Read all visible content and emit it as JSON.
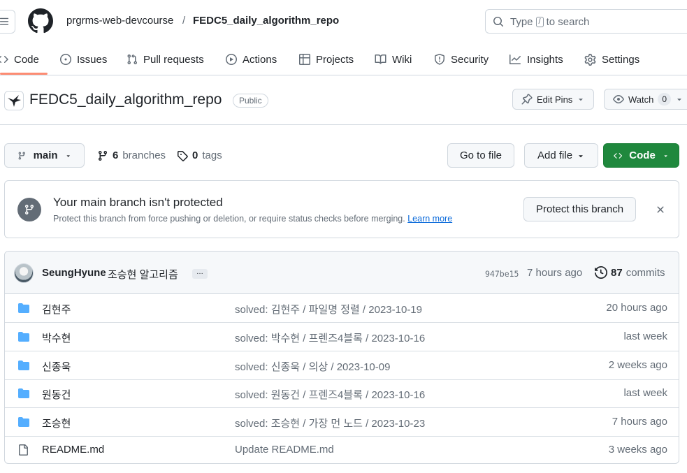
{
  "header": {
    "owner": "prgrms-web-devcourse",
    "separator": "/",
    "repo": "FEDC5_daily_algorithm_repo",
    "search_before": "Type",
    "search_key": "/",
    "search_after": "to search"
  },
  "tabs": [
    {
      "label": "Code",
      "icon": "code-icon"
    },
    {
      "label": "Issues",
      "icon": "issue-icon"
    },
    {
      "label": "Pull requests",
      "icon": "pull-request-icon"
    },
    {
      "label": "Actions",
      "icon": "play-icon"
    },
    {
      "label": "Projects",
      "icon": "table-icon"
    },
    {
      "label": "Wiki",
      "icon": "book-icon"
    },
    {
      "label": "Security",
      "icon": "shield-icon"
    },
    {
      "label": "Insights",
      "icon": "graph-icon"
    },
    {
      "label": "Settings",
      "icon": "gear-icon"
    }
  ],
  "repo_head": {
    "title": "FEDC5_daily_algorithm_repo",
    "visibility": "Public",
    "edit_pins": "Edit Pins",
    "watch": "Watch",
    "watch_count": "0"
  },
  "branch_bar": {
    "branch": "main",
    "branches_count": "6",
    "branches_label": "branches",
    "tags_count": "0",
    "tags_label": "tags",
    "go_to_file": "Go to file",
    "add_file": "Add file",
    "code": "Code"
  },
  "protect": {
    "title": "Your main branch isn't protected",
    "description": "Protect this branch from force pushing or deletion, or require status checks before merging.",
    "link": "Learn more",
    "button": "Protect this branch"
  },
  "commit": {
    "author": "SeungHyune",
    "message": "조승현 알고리즘",
    "ellipsis": "…",
    "sha": "947be15",
    "time": "7 hours ago",
    "count": "87",
    "count_label": "commits"
  },
  "files": [
    {
      "name": "김현주",
      "type": "folder",
      "message": "solved: 김현주 / 파일명 정렬 / 2023-10-19",
      "time": "20 hours ago"
    },
    {
      "name": "박수현",
      "type": "folder",
      "message": "solved: 박수현 / 프렌즈4블록 / 2023-10-16",
      "time": "last week"
    },
    {
      "name": "신종욱",
      "type": "folder",
      "message": "solved: 신종욱 / 의상 / 2023-10-09",
      "time": "2 weeks ago"
    },
    {
      "name": "원동건",
      "type": "folder",
      "message": "solved: 원동건 / 프렌즈4블록 / 2023-10-16",
      "time": "last week"
    },
    {
      "name": "조승현",
      "type": "folder",
      "message": "solved: 조승현 / 가장 먼 노드 / 2023-10-23",
      "time": "7 hours ago"
    },
    {
      "name": "README.md",
      "type": "file",
      "message": "Update README.md",
      "time": "3 weeks ago"
    }
  ],
  "colors": {
    "accent_green": "#1f883d",
    "link_blue": "#0969da",
    "folder_blue": "#54aeff",
    "tab_underline": "#fd8c73"
  }
}
